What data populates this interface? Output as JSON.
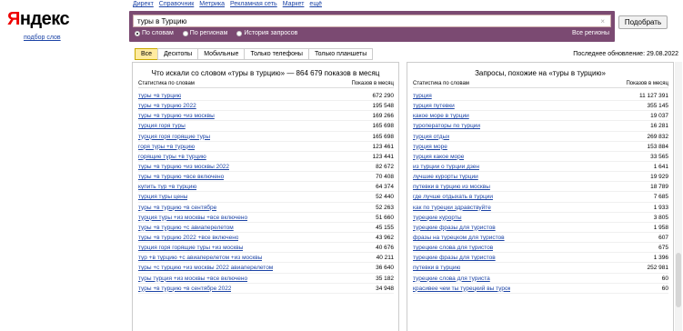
{
  "logo": {
    "first": "Я",
    "rest": "ндекс",
    "sub": "подбор слов"
  },
  "topnav": [
    "Директ",
    "Справочник",
    "Метрика",
    "Рекламная сеть",
    "Маркет",
    "ещё"
  ],
  "search": {
    "value": "туры в Турцию",
    "clear": "×",
    "submit": "Подобрать"
  },
  "radios": [
    {
      "label": "По словам",
      "on": true
    },
    {
      "label": "По регионам",
      "on": false
    },
    {
      "label": "История запросов",
      "on": false
    }
  ],
  "regions": "Все регионы",
  "tabs": [
    {
      "label": "Все",
      "active": true
    },
    {
      "label": "Десктопы",
      "active": false
    },
    {
      "label": "Мобильные",
      "active": false
    },
    {
      "label": "Только телефоны",
      "active": false
    },
    {
      "label": "Только планшеты",
      "active": false
    }
  ],
  "updated": "Последнее обновление: 29.08.2022",
  "left": {
    "title": "Что искали со словом «туры в турцию» — 864 679 показов в месяц",
    "col_query": "Статистика по словам",
    "col_count": "Показов в месяц",
    "rows": [
      {
        "q": "туры +в турцию",
        "c": "672 290"
      },
      {
        "q": "туры +в турцию 2022",
        "c": "195 548"
      },
      {
        "q": "туры +в турцию +из москвы",
        "c": "169 266"
      },
      {
        "q": "турция горя туры",
        "c": "165 698"
      },
      {
        "q": "турция горя горящие туры",
        "c": "165 698"
      },
      {
        "q": "горя туры +в турцию",
        "c": "123 461"
      },
      {
        "q": "горящие туры +в турцию",
        "c": "123 441"
      },
      {
        "q": "туры +в турцию +из москвы 2022",
        "c": "82 672"
      },
      {
        "q": "туры +в турцию +все включено",
        "c": "70 408"
      },
      {
        "q": "купить тур +в турцию",
        "c": "64 374"
      },
      {
        "q": "турция туры цены",
        "c": "52 440"
      },
      {
        "q": "туры +в турцию +в сентябре",
        "c": "52 263"
      },
      {
        "q": "турция туры +из москвы +все включено",
        "c": "51 660"
      },
      {
        "q": "туры +в турцию +с авиаперелетом",
        "c": "45 155"
      },
      {
        "q": "туры +в турцию 2022 +все включено",
        "c": "43 962"
      },
      {
        "q": "турция горя горящие туры +из москвы",
        "c": "40 676"
      },
      {
        "q": "тур +в турцию +с авиаперелетом +из москвы",
        "c": "40 211"
      },
      {
        "q": "туры +с турцию +из москвы 2022 авиаперелетом",
        "c": "36 640"
      },
      {
        "q": "туры турция +из москвы +все включено",
        "c": "35 182"
      },
      {
        "q": "туры +в турцию +в сентябре 2022",
        "c": "34 948"
      }
    ]
  },
  "right": {
    "title": "Запросы, похожие на «туры в турцию»",
    "col_query": "Статистика по словам",
    "col_count": "Показов в месяц",
    "rows": [
      {
        "q": "турция",
        "c": "11 127 391"
      },
      {
        "q": "турция путевки",
        "c": "355 145"
      },
      {
        "q": "какое море в турции",
        "c": "19 037"
      },
      {
        "q": "туроператоры по турции",
        "c": "16 281"
      },
      {
        "q": "турция отдых",
        "c": "269 832"
      },
      {
        "q": "турция море",
        "c": "153 884"
      },
      {
        "q": "турция какое море",
        "c": "33 565"
      },
      {
        "q": "из турции о турции дзен",
        "c": "1 641"
      },
      {
        "q": "лучшие курорты турции",
        "c": "19 929"
      },
      {
        "q": "путевки в турцию из москвы",
        "c": "18 789"
      },
      {
        "q": "где лучше отдыхать в турции",
        "c": "7 685"
      },
      {
        "q": "как по турецки здравствуйте",
        "c": "1 933"
      },
      {
        "q": "турецкие курорты",
        "c": "3 805"
      },
      {
        "q": "турецкие фразы для туристов",
        "c": "1 958"
      },
      {
        "q": "фразы на турецком для туристов",
        "c": "607"
      },
      {
        "q": "турецкие слова для туристов",
        "c": "675"
      },
      {
        "q": "турецкие фразы для туристов",
        "c": "1 396"
      },
      {
        "q": "путевки в турцию",
        "c": "252 981"
      },
      {
        "q": "турецкие слова для туриста",
        "c": "60"
      },
      {
        "q": "красивее чем ты турецкий вы турок",
        "c": "60"
      }
    ]
  }
}
